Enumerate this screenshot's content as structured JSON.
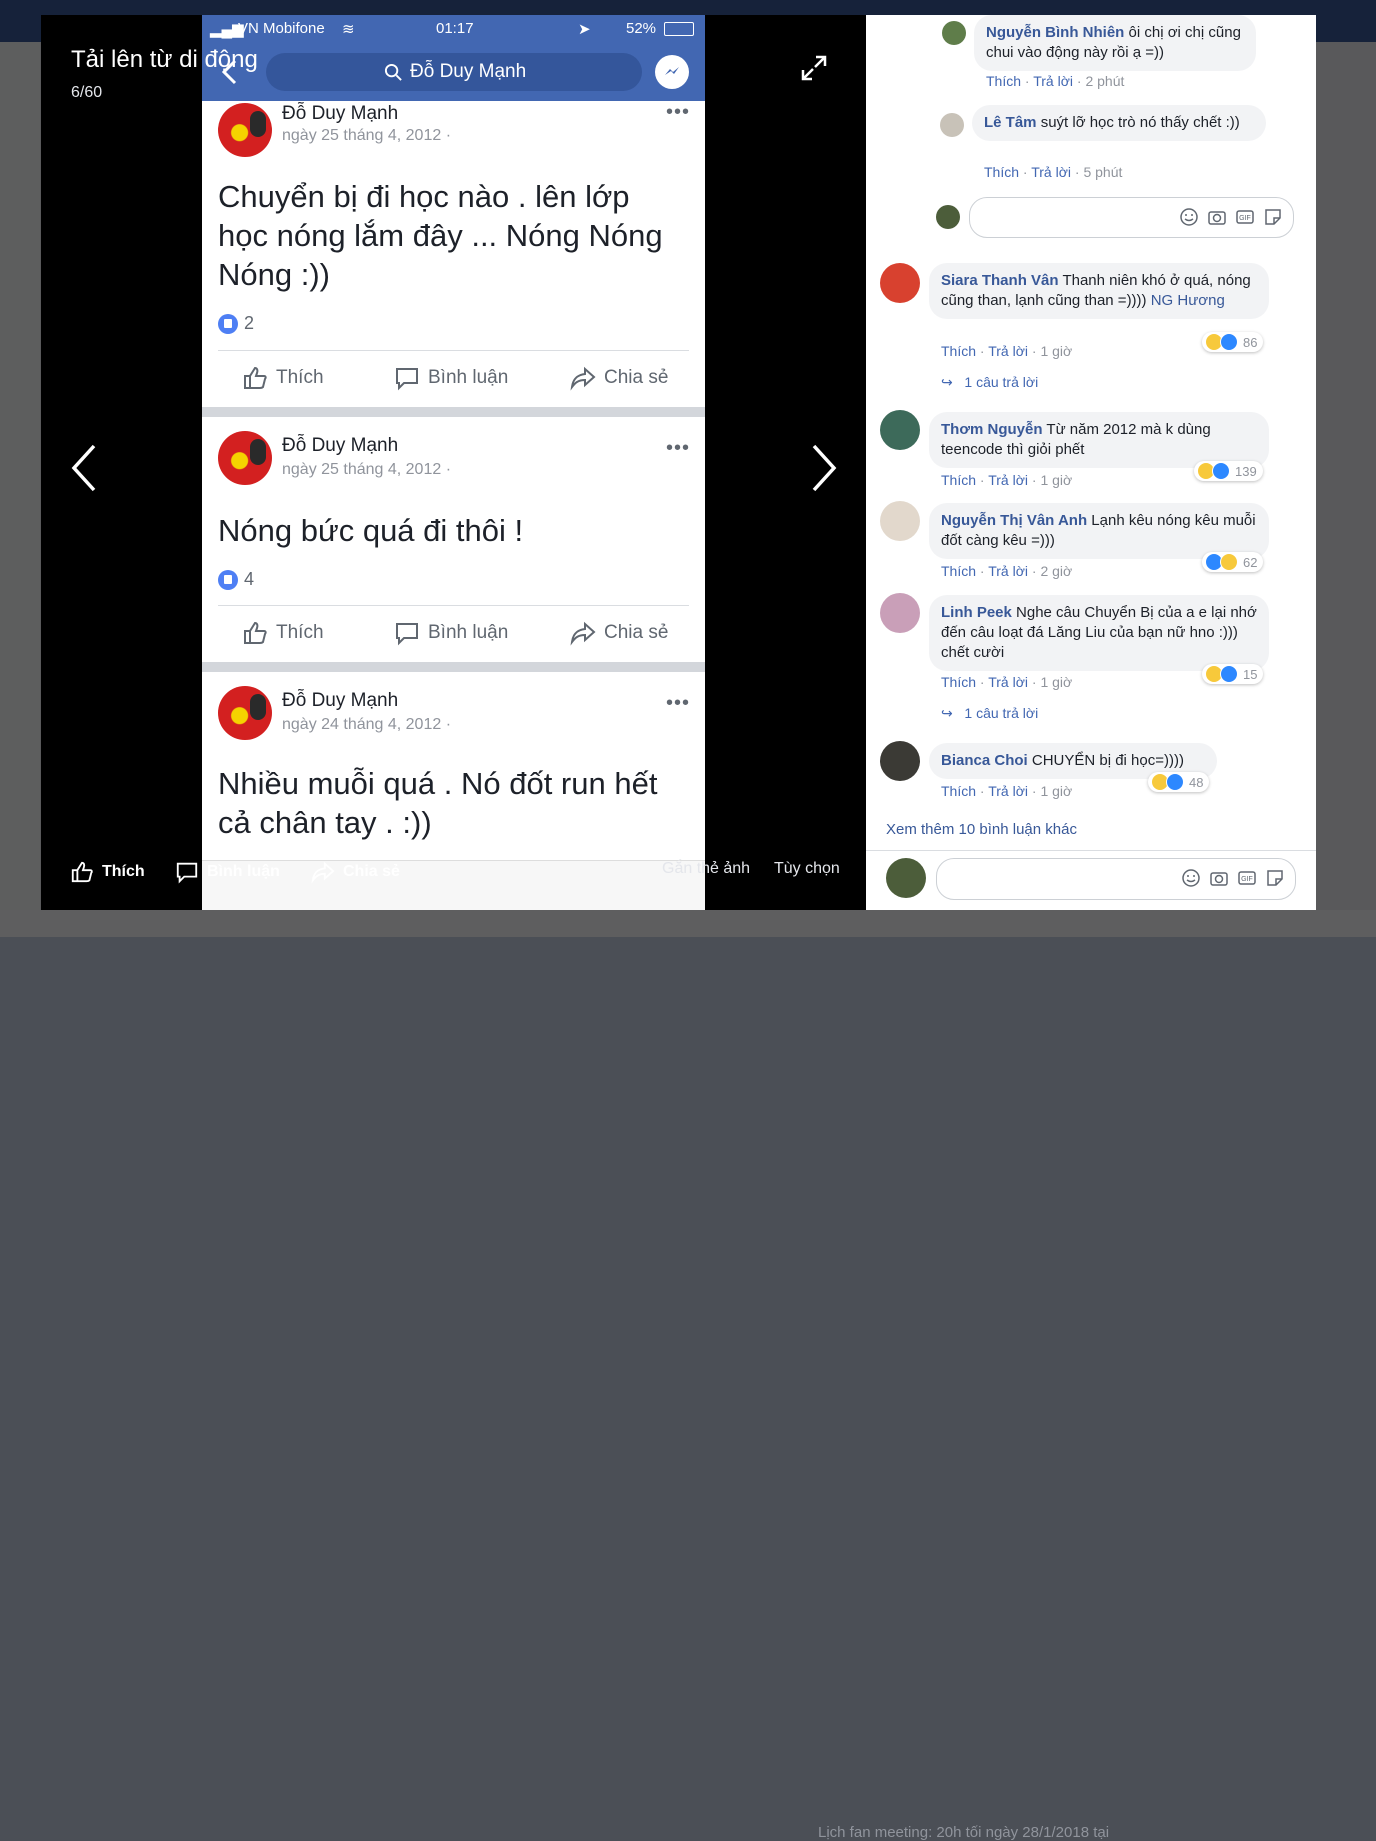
{
  "viewer": {
    "title": "Tải lên từ di động",
    "counter": "6/60",
    "bottom_actions": {
      "like": "Thích",
      "comment": "Bình luận",
      "share": "Chia sẻ",
      "tag": "Gắn thẻ ảnh",
      "options": "Tùy chọn"
    }
  },
  "background": {
    "footer_text": "Lịch fan meeting: 20h tối ngày 28/1/2018 tại"
  },
  "phone": {
    "carrier": "VN Mobifone",
    "time": "01:17",
    "battery": "52%",
    "search_text": "Đỗ Duy Mạnh",
    "posts": [
      {
        "author": "Đỗ Duy Mạnh",
        "date": "ngày 25 tháng 4, 2012 ·",
        "text": "Chuyển bị đi học nào . lên lớp học nóng lắm đây ... Nóng Nóng Nóng :))",
        "likes": "2",
        "action_like": "Thích",
        "action_comment": "Bình luận",
        "action_share": "Chia sẻ"
      },
      {
        "author": "Đỗ Duy Mạnh",
        "date": "ngày 25 tháng 4, 2012 ·",
        "text": "Nóng bức quá đi thôi !",
        "likes": "4",
        "action_like": "Thích",
        "action_comment": "Bình luận",
        "action_share": "Chia sẻ"
      },
      {
        "author": "Đỗ Duy Mạnh",
        "date": "ngày 24 tháng 4, 2012 ·",
        "text": "Nhiều muỗi quá . Nó đốt run hết cả chân tay . :))"
      }
    ]
  },
  "comments": {
    "replies": [
      {
        "name": "Nguyễn Bình Nhiên",
        "text": "ôi chị ơi chị cũng chui vào động này rồi ạ =))",
        "like": "Thích",
        "reply": "Trả lời",
        "time": "2 phút"
      },
      {
        "name": "Lê Tâm",
        "text": "suýt lỡ học trò nó thấy chết :))",
        "like": "Thích",
        "reply": "Trả lời",
        "time": "5 phút"
      }
    ],
    "items": [
      {
        "name": "Siara Thanh Vân",
        "text": "Thanh niên khó ở quá, nóng cũng than, lạnh cũng than =)))) ",
        "mention": "NG Hương",
        "like": "Thích",
        "reply": "Trả lời",
        "time": "1 giờ",
        "reactions": "86",
        "reply_count": "1 câu trả lời"
      },
      {
        "name": "Thơm Nguyễn",
        "text": "Từ năm 2012 mà k dùng teencode thì giỏi phết",
        "like": "Thích",
        "reply": "Trả lời",
        "time": "1 giờ",
        "reactions": "139"
      },
      {
        "name": "Nguyễn Thị Vân Anh",
        "text": "Lạnh kêu nóng kêu muỗi đốt càng kêu =)))",
        "like": "Thích",
        "reply": "Trả lời",
        "time": "2 giờ",
        "reactions": "62"
      },
      {
        "name": "Linh Peek",
        "text": "Nghe câu Chuyển Bị của a e lại nhớ đến câu loạt đá Lăng Liu của bạn nữ hno :))) chết cười",
        "like": "Thích",
        "reply": "Trả lời",
        "time": "1 giờ",
        "reactions": "15",
        "reply_count": "1 câu trả lời"
      },
      {
        "name": "Bianca Choi",
        "text": "CHUYỂN bị đi học=))))",
        "like": "Thích",
        "reply": "Trả lời",
        "time": "1 giờ",
        "reactions": "48"
      }
    ],
    "more_link": "Xem thêm 10 bình luận khác"
  },
  "colors": {
    "facebook_blue": "#4267b2",
    "name_blue": "#385898",
    "like_blue": "#2d88ff",
    "haha_yellow": "#f7c93b"
  }
}
